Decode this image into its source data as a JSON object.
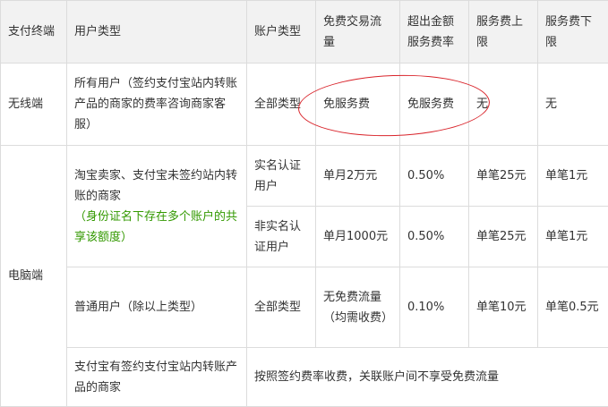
{
  "header": {
    "terminal": "支付终端",
    "user_type": "用户类型",
    "account_type": "账户类型",
    "free_volume": "免费交易流量",
    "excess_rate": "超出金额服务费率",
    "fee_max": "服务费上限",
    "fee_min": "服务费下限"
  },
  "wireless": {
    "terminal": "无线端",
    "user_type": "所有用户（签约支付宝站内转账产品的商家的费率咨询商家客服）",
    "account_type": "全部类型",
    "free_volume": "免服务费",
    "excess_rate": "免服务费",
    "fee_max": "无",
    "fee_min": "无"
  },
  "pc": {
    "terminal": "电脑端",
    "group1": {
      "user_type": "淘宝卖家、支付宝未签约站内转账的商家",
      "note": "（身份证名下存在多个账户的共享该额度）",
      "verified": {
        "account_type": "实名认证用户",
        "free_volume": "单月2万元",
        "excess_rate": "0.50%",
        "fee_max": "单笔25元",
        "fee_min": "单笔1元"
      },
      "unverified": {
        "account_type": "非实名认证用户",
        "free_volume": "单月1000元",
        "excess_rate": "0.50%",
        "fee_max": "单笔25元",
        "fee_min": "单笔1元"
      }
    },
    "group2": {
      "user_type": "普通用户（除以上类型）",
      "account_type": "全部类型",
      "free_volume": "无免费流量（均需收费）",
      "excess_rate": "0.10%",
      "fee_max": "单笔10元",
      "fee_min": "单笔0.5元"
    },
    "group3": {
      "user_type": "支付宝有签约支付宝站内转账产品的商家",
      "policy": "按照签约费率收费，关联账户间不享受免费流量"
    }
  },
  "colors": {
    "highlight_ellipse": "#d9242b",
    "note_text": "#339900",
    "header_background": "#f2f2f2",
    "border": "#dcdcdc"
  }
}
